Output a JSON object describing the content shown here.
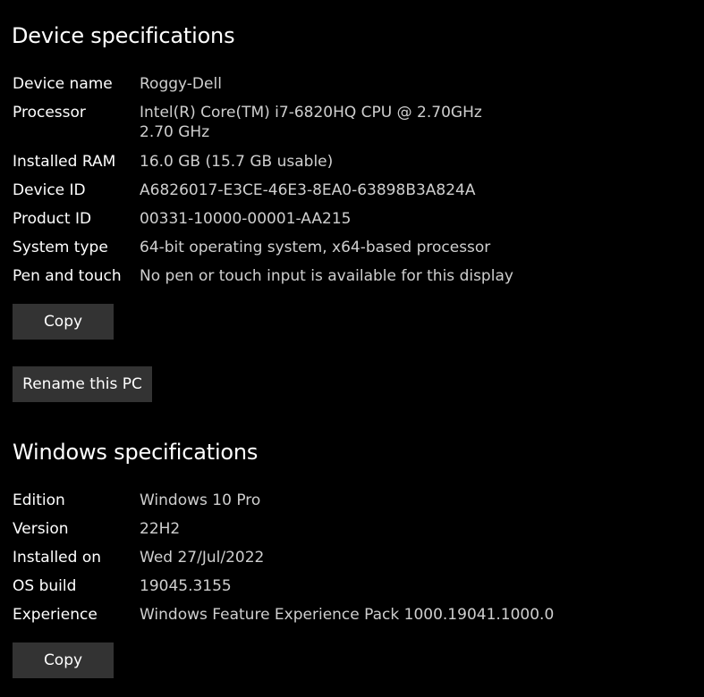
{
  "device": {
    "title": "Device specifications",
    "rows": [
      {
        "label": "Device name",
        "value": "Roggy-Dell"
      },
      {
        "label": "Processor",
        "value": "Intel(R) Core(TM) i7-6820HQ CPU @ 2.70GHz   2.70 GHz"
      },
      {
        "label": "Installed RAM",
        "value": "16.0 GB (15.7 GB usable)"
      },
      {
        "label": "Device ID",
        "value": "A6826017-E3CE-46E3-8EA0-63898B3A824A"
      },
      {
        "label": "Product ID",
        "value": "00331-10000-00001-AA215"
      },
      {
        "label": "System type",
        "value": "64-bit operating system, x64-based processor"
      },
      {
        "label": "Pen and touch",
        "value": "No pen or touch input is available for this display"
      }
    ],
    "copy_label": "Copy",
    "rename_label": "Rename this PC"
  },
  "windows": {
    "title": "Windows specifications",
    "rows": [
      {
        "label": "Edition",
        "value": "Windows 10 Pro"
      },
      {
        "label": "Version",
        "value": "22H2"
      },
      {
        "label": "Installed on",
        "value": "Wed 27/Jul/2022"
      },
      {
        "label": "OS build",
        "value": "19045.3155"
      },
      {
        "label": "Experience",
        "value": "Windows Feature Experience Pack 1000.19041.1000.0"
      }
    ],
    "copy_label": "Copy"
  },
  "colors": {
    "background": "#000000",
    "label": "#ffffff",
    "value": "#cfcfcf",
    "button_bg": "#333333"
  }
}
